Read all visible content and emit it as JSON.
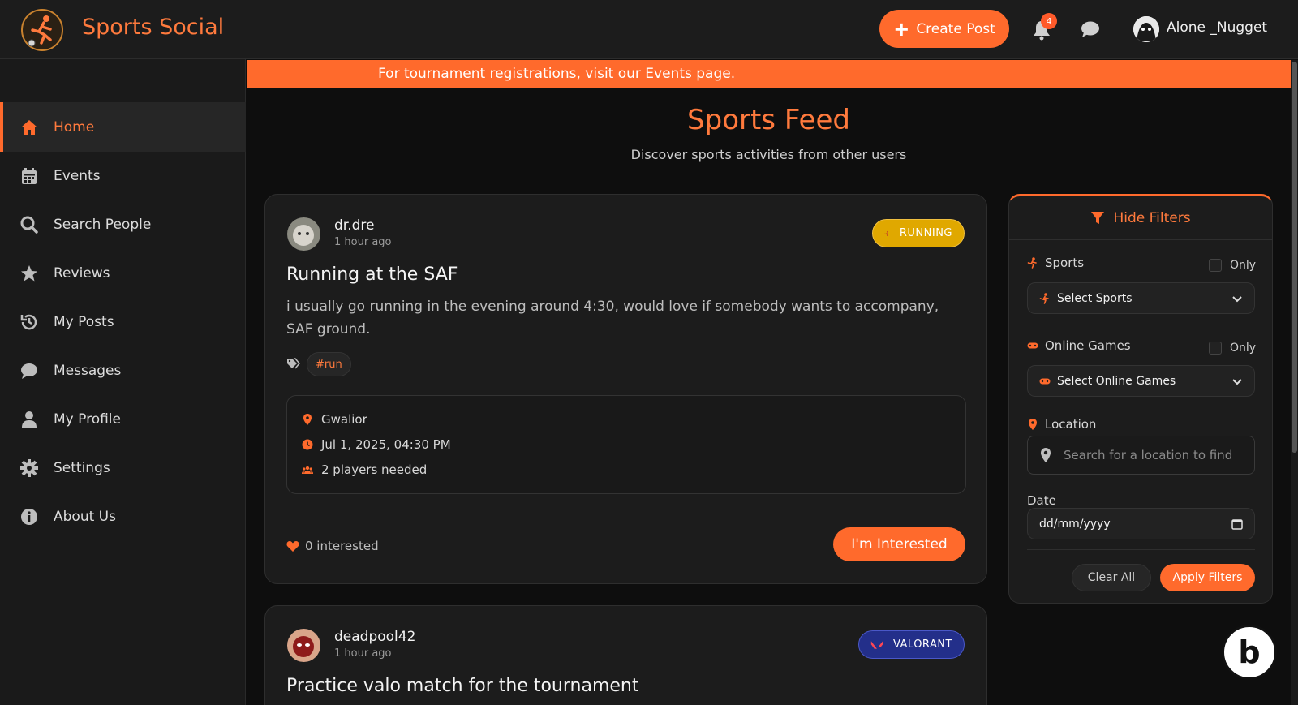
{
  "header": {
    "app_title": "Sports Social",
    "create_post_label": "Create Post",
    "notification_count": "4",
    "user_name": "Alone _Nugget"
  },
  "sidebar": {
    "items": [
      {
        "label": "Home",
        "icon": "home-icon",
        "active": true
      },
      {
        "label": "Events",
        "icon": "calendar-icon"
      },
      {
        "label": "Search People",
        "icon": "search-icon"
      },
      {
        "label": "Reviews",
        "icon": "star-icon"
      },
      {
        "label": "My Posts",
        "icon": "history-icon"
      },
      {
        "label": "Messages",
        "icon": "chat-bubble-icon"
      },
      {
        "label": "My Profile",
        "icon": "user-icon"
      },
      {
        "label": "Settings",
        "icon": "gear-icon"
      },
      {
        "label": "About Us",
        "icon": "info-icon"
      }
    ]
  },
  "banner": {
    "text": "For tournament registrations, visit our Events page."
  },
  "feed": {
    "title": "Sports Feed",
    "subtitle": "Discover sports activities from other users"
  },
  "posts": [
    {
      "user": "dr.dre",
      "time": "1 hour ago",
      "tag": "RUNNING",
      "title": "Running at the SAF",
      "body": "i usually go running in the evening around 4:30, would love if somebody wants to accompany, SAF ground.",
      "hashtag": "#run",
      "location": "Gwalior",
      "datetime": "Jul 1, 2025, 04:30 PM",
      "players": "2 players needed",
      "interested": "0 interested",
      "interest_button": "I'm Interested"
    },
    {
      "user": "deadpool42",
      "time": "1 hour ago",
      "tag": "VALORANT",
      "title": "Practice valo match for the tournament"
    }
  ],
  "filters": {
    "toggle_label": "Hide Filters",
    "sports_label": "Sports",
    "only_label": "Only",
    "sports_select": "Select Sports",
    "games_label": "Online Games",
    "games_select": "Select Online Games",
    "location_label": "Location",
    "location_placeholder": "Search for a location to find",
    "date_label": "Date",
    "date_placeholder": "dd/mm/yyyy",
    "clear_label": "Clear All",
    "apply_label": "Apply Filters"
  },
  "colors": {
    "accent": "#ff6a2c",
    "background": "#0e0e0e",
    "panel": "#1c1c1c",
    "running_tag": "#e0a800",
    "valorant_tag": "#232f8a"
  }
}
